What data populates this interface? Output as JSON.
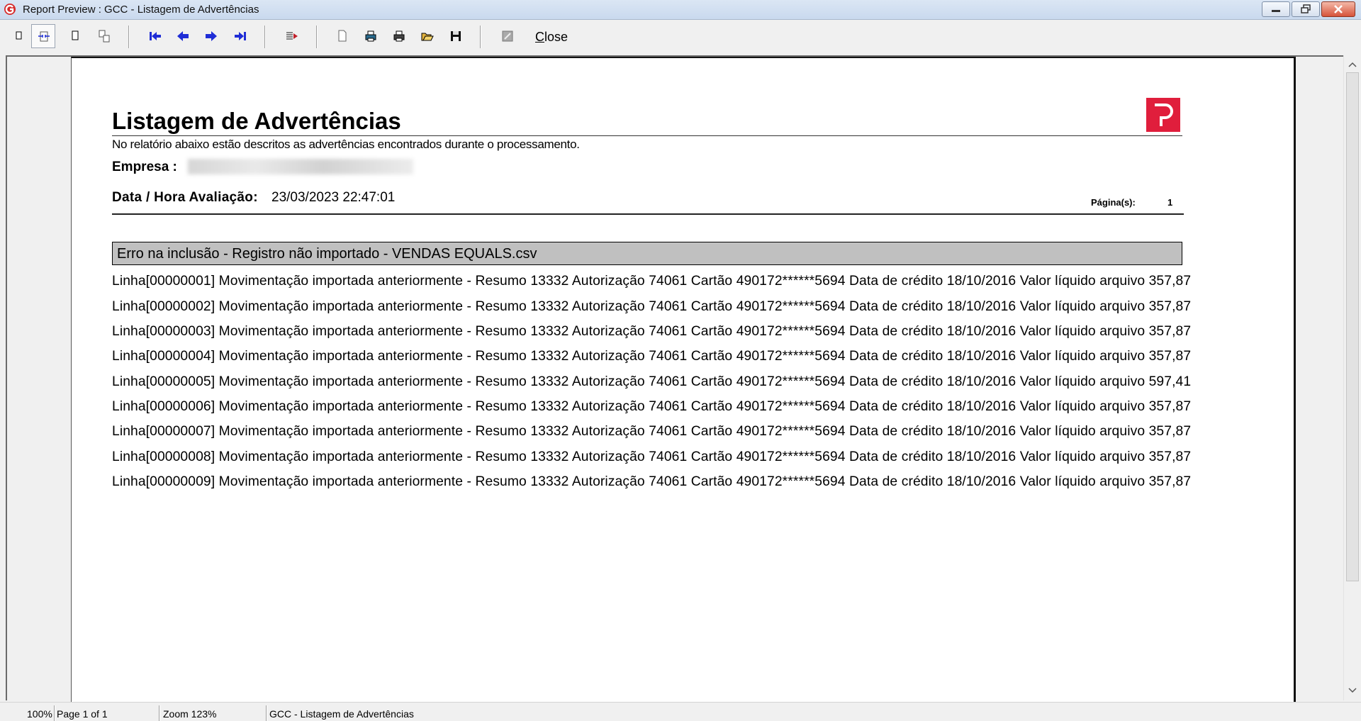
{
  "window": {
    "title": "Report Preview : GCC - Listagem de Advertências"
  },
  "toolbar": {
    "buttons": [
      {
        "icon": "single-page-icon"
      },
      {
        "icon": "page-width-icon"
      },
      {
        "icon": "full-page-icon"
      },
      {
        "icon": "multi-page-icon"
      },
      {
        "icon": "first-page-icon"
      },
      {
        "icon": "previous-page-icon"
      },
      {
        "icon": "next-page-icon"
      },
      {
        "icon": "last-page-icon"
      },
      {
        "icon": "goto-page-icon"
      },
      {
        "icon": "page-setup-icon"
      },
      {
        "icon": "printer-setup-icon"
      },
      {
        "icon": "print-icon"
      },
      {
        "icon": "open-file-icon"
      },
      {
        "icon": "save-icon"
      },
      {
        "icon": "export-icon"
      }
    ],
    "close_label": "Close",
    "nav_color": "#1f2dd6"
  },
  "report": {
    "title": "Listagem de Advertências",
    "subtitle": "No relatório abaixo estão descritos as advertências encontrados durante o processamento.",
    "empresa_label": "Empresa :",
    "datetime_label": "Data / Hora Avaliação:",
    "datetime_value": "23/03/2023 22:47:01",
    "pages_label": "Página(s):",
    "pages_value": "1",
    "logo_color": "#e01e3c",
    "group_header": "Erro na inclusão - Registro não importado - VENDAS EQUALS.csv",
    "lines": [
      "Linha[00000001] Movimentação importada anteriormente - Resumo 13332 Autorização 74061 Cartão 490172******5694 Data de crédito 18/10/2016 Valor líquido arquivo 357,87",
      "Linha[00000002] Movimentação importada anteriormente - Resumo 13332 Autorização 74061 Cartão 490172******5694 Data de crédito 18/10/2016 Valor líquido arquivo 357,87",
      "Linha[00000003] Movimentação importada anteriormente - Resumo 13332 Autorização 74061 Cartão 490172******5694 Data de crédito 18/10/2016 Valor líquido arquivo 357,87",
      "Linha[00000004] Movimentação importada anteriormente - Resumo 13332 Autorização 74061 Cartão 490172******5694 Data de crédito 18/10/2016 Valor líquido arquivo 357,87",
      "Linha[00000005] Movimentação importada anteriormente - Resumo 13332 Autorização 74061 Cartão 490172******5694 Data de crédito 18/10/2016 Valor líquido arquivo 597,41",
      "Linha[00000006] Movimentação importada anteriormente - Resumo 13332 Autorização 74061 Cartão 490172******5694 Data de crédito 18/10/2016 Valor líquido arquivo 357,87",
      "Linha[00000007] Movimentação importada anteriormente - Resumo 13332 Autorização 74061 Cartão 490172******5694 Data de crédito 18/10/2016 Valor líquido arquivo 357,87",
      "Linha[00000008] Movimentação importada anteriormente - Resumo 13332 Autorização 74061 Cartão 490172******5694 Data de crédito 18/10/2016 Valor líquido arquivo 357,87",
      "Linha[00000009] Movimentação importada anteriormente - Resumo 13332 Autorização 74061 Cartão 490172******5694 Data de crédito 18/10/2016 Valor líquido arquivo 357,87"
    ]
  },
  "statusbar": {
    "percent": "100%",
    "page": "Page 1 of 1",
    "zoom": "Zoom 123%",
    "report_name": "GCC - Listagem de Advertências"
  }
}
